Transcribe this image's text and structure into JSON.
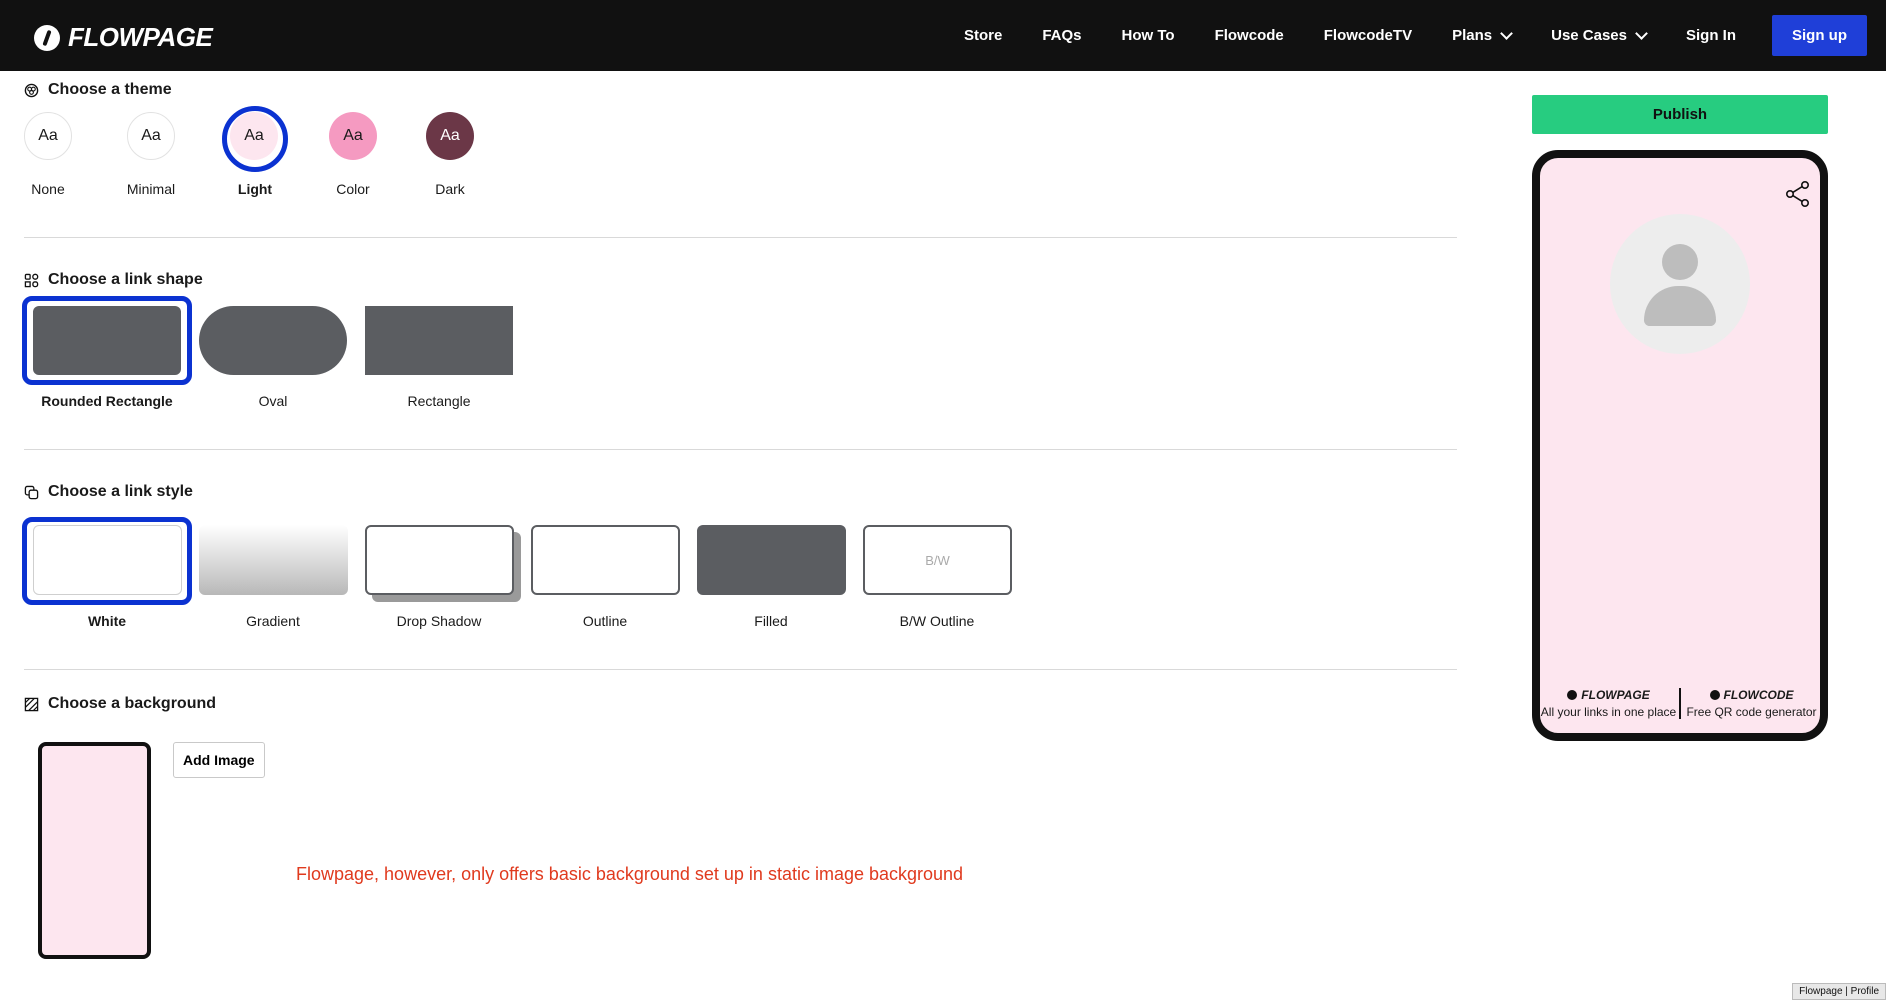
{
  "nav": {
    "logo_text": "FLOWPAGE",
    "links": [
      "Store",
      "FAQs",
      "How To",
      "Flowcode",
      "FlowcodeTV",
      "Plans",
      "Use Cases",
      "Sign In"
    ],
    "signup_label": "Sign up"
  },
  "theme_section": {
    "title": "Choose a theme",
    "options": [
      {
        "glyph": "Aa",
        "label": "None",
        "bg": "#ffffff",
        "text_color": "#111111"
      },
      {
        "glyph": "Aa",
        "label": "Minimal",
        "bg": "#ffffff",
        "text_color": "#111111"
      },
      {
        "glyph": "Aa",
        "label": "Light",
        "bg": "#fde6ef",
        "text_color": "#111111"
      },
      {
        "glyph": "Aa",
        "label": "Color",
        "bg": "#f59ac1",
        "text_color": "#111111"
      },
      {
        "glyph": "Aa",
        "label": "Dark",
        "bg": "#6b3747",
        "text_color": "#ffffff"
      }
    ],
    "selected": "Light"
  },
  "shape_section": {
    "title": "Choose a link shape",
    "options": [
      "Rounded Rectangle",
      "Oval",
      "Rectangle"
    ],
    "selected": "Rounded Rectangle"
  },
  "style_section": {
    "title": "Choose a link style",
    "options": [
      "White",
      "Gradient",
      "Drop Shadow",
      "Outline",
      "Filled",
      "B/W Outline"
    ],
    "bw_glyph": "B/W",
    "selected": "White"
  },
  "background_section": {
    "title": "Choose a background",
    "add_image_label": "Add Image",
    "note": "Flowpage, however, only offers basic background set up in static image background"
  },
  "preview": {
    "publish_label": "Publish",
    "footer": [
      {
        "brand": "FLOWPAGE",
        "text": "All your links in one place"
      },
      {
        "brand": "FLOWCODE",
        "text": "Free QR code generator"
      }
    ]
  },
  "tab_label": "Flowpage | Profile",
  "colors": {
    "accent": "#0b32d1",
    "publish": "#27cc80",
    "signup": "#1f3fd8",
    "note": "#e03a1e",
    "phone_bg": "#fde6ef",
    "link_gray": "#5b5d61"
  }
}
